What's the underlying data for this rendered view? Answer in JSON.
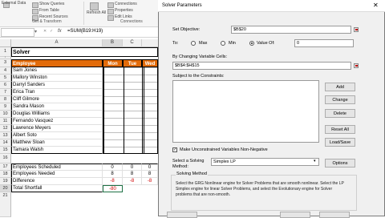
{
  "ribbon": {
    "row1": [
      "External\nData",
      "Show Queries",
      "From Table",
      "Recent Sources",
      "Refresh\nAll",
      "Connections",
      "Properties",
      "Edit Links"
    ],
    "groups": [
      "Get & Transform",
      "Connections"
    ]
  },
  "formula_bar": {
    "name_box": "",
    "fx": "fx",
    "formula": "=SUM(B19:H19)"
  },
  "sheet": {
    "col_a": "A",
    "col_b": "B",
    "col_c": "C",
    "rows": [
      "1",
      "2",
      "3",
      "4",
      "5",
      "6",
      "7",
      "8",
      "9",
      "10",
      "11",
      "12",
      "13",
      "14",
      "15",
      "16",
      "17",
      "18",
      "19",
      "20",
      "21"
    ],
    "title": "Solver",
    "header": {
      "employee": "Employee",
      "mon": "Mon",
      "tue": "Tue",
      "wed": "Wed"
    },
    "employees": [
      "Sam Jones",
      "Mallory Winston",
      "Darryl Sanders",
      "Erica Tran",
      "Cliff Gilmore",
      "Sandra Mason",
      "Douglas Williams",
      "Fernando Vasquez",
      "Lawrence Meyers",
      "Albert Soto",
      "Matthew Sloan",
      "Tamara Walsh"
    ],
    "summary": [
      {
        "label": "Employees Scheduled",
        "mon": "0",
        "tue": "0",
        "wed": "0"
      },
      {
        "label": "Employees Needed",
        "mon": "8",
        "tue": "8",
        "wed": "8"
      },
      {
        "label": "Difference",
        "mon": "-8",
        "tue": "-8",
        "wed": "-8"
      },
      {
        "label": "Total Shortfall",
        "mon": "-80",
        "tue": "",
        "wed": ""
      }
    ]
  },
  "dialog": {
    "title": "Solver Parameters",
    "set_objective_label": "Set Objective:",
    "objective_value": "$B$20",
    "to_label": "To:",
    "max_label": "Max",
    "min_label": "Min",
    "value_of_label": "Value Of:",
    "value_of_value": "0",
    "changing_label": "By Changing Variable Cells:",
    "changing_value": "$B$4:$H$15",
    "constraints_label": "Subject to the Constraints:",
    "btn_add": "Add",
    "btn_change": "Change",
    "btn_delete": "Delete",
    "btn_reset": "Reset All",
    "btn_load": "Load/Save",
    "nonneg_label": "Make Unconstrained Variables Non-Negative",
    "method_label_1": "Select a Solving",
    "method_label_2": "Method:",
    "method_value": "Simplex LP",
    "btn_options": "Options",
    "solving_method_title": "Solving Method",
    "desc_1": "Select the GRG Nonlinear engine for Solver Problems that are smooth nonlinear. Select the LP",
    "desc_2": "Simplex engine for linear Solver Problems, and select the Evolutionary engine for Solver",
    "desc_3": "problems that are non-smooth."
  }
}
